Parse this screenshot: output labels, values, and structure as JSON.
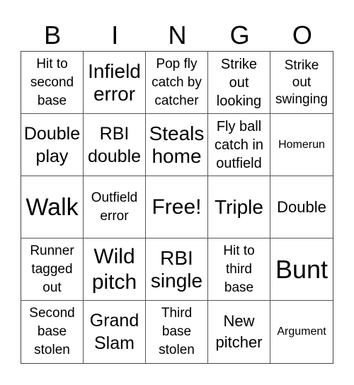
{
  "header": {
    "letters": [
      "B",
      "I",
      "N",
      "G",
      "O"
    ]
  },
  "cells": [
    [
      "Hit to\nsecond\nbase",
      "Infield\nerror",
      "Pop fly\ncatch by\ncatcher",
      "Strike\nout\nlooking",
      "Strike\nout\nswinging"
    ],
    [
      "Double\nplay",
      "RBI\ndouble",
      "Steals\nhome",
      "Fly ball\ncatch in\noutfield",
      "Homerun"
    ],
    [
      "Walk",
      "Outfield\nerror",
      "Free!",
      "Triple",
      "Double"
    ],
    [
      "Runner\ntagged\nout",
      "Wild\npitch",
      "RBI\nsingle",
      "Hit to\nthird\nbase",
      "Bunt"
    ],
    [
      "Second\nbase\nstolen",
      "Grand\nSlam",
      "Third\nbase\nstolen",
      "New\npitcher",
      "Argument"
    ]
  ]
}
